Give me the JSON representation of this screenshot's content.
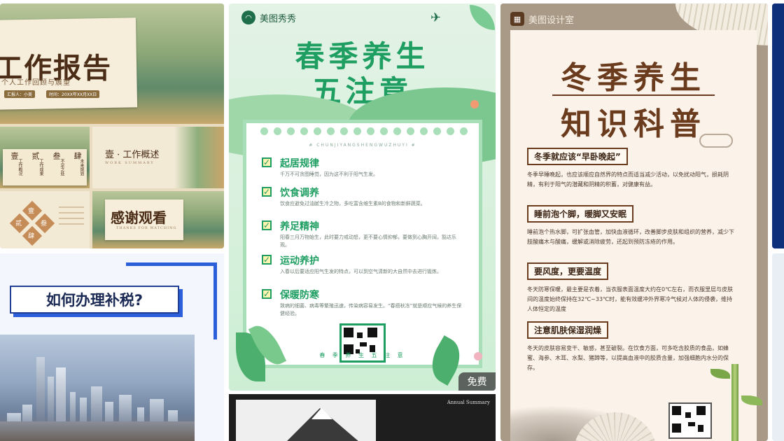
{
  "card_work_report": {
    "title": "工作报告",
    "subtitle": "个人工作回顾与展望",
    "meta_left": "汇报人：小美",
    "meta_right": "时间：20XX年XX月XX日",
    "section_titles": [
      "壹",
      "贰",
      "叁",
      "肆"
    ],
    "section_labels": [
      "工作概况",
      "工作成果",
      "不足之处",
      "未来规划"
    ],
    "overview_title": "壹 · 工作概述",
    "overview_sub": "WORK SUMMARY",
    "diamond_labels": [
      "壹",
      "贰",
      "叁",
      "肆"
    ],
    "thanks_title": "感谢观看",
    "thanks_sub": "THANKS FOR WATCHING"
  },
  "card_tax": {
    "title": "如何办理补税?"
  },
  "card_spring": {
    "brand": "美图秀秀",
    "title_line1": "春季养生",
    "title_line2": "五注意",
    "pinyin": "# CHUNJIYANGSHENGWUZHUYI #",
    "items": [
      {
        "heading": "起居规律",
        "text": "千万不可贪图睡觉，因为这不利于阳气生发。"
      },
      {
        "heading": "饮食调养",
        "text": "饮食应避免过油腻生冷之物，多吃富含维生素B的食物和新鲜蔬菜。"
      },
      {
        "heading": "养足精神",
        "text": "阳春三月万物始生，此时要力戒动怒，更不要心情抑郁，要做到心胸开阔，豁达乐观。"
      },
      {
        "heading": "运动养护",
        "text": "入春以后要适应阳气生发的特点，可以到空气清新的大自然中去进行锻炼。"
      },
      {
        "heading": "保暖防寒",
        "text": "致病的细菌、病毒等繁殖迅速，传染病容易发生。“春捂秋冻”就是顺应气候的养生保健经验。"
      }
    ],
    "footer": "春 季 养 生 五 注 意",
    "badge": "免费"
  },
  "card_winter": {
    "brand": "美图设计室",
    "title_line1": "冬季养生",
    "title_line2": "知识科普",
    "sections": [
      {
        "heading": "冬季就应该“早卧晚起”",
        "text": "冬季早睡晚起，也应该顺应自然界的特点而适当减少活动，以免扰动阳气，损耗阴精，有利于阳气的潜藏和阴精的积蓄，对健康有益。"
      },
      {
        "heading": "睡前泡个脚，暖脚又安眠",
        "text": "睡前泡个热水脚，可扩张血管，加快血液循环，改善脚步皮肤和组织的营养，减少下肢酸痛木与酸痛，缓解或消除疲劳，还起到预防冻疮的作用。"
      },
      {
        "heading": "要风度，更要温度",
        "text": "冬天防寒保暖，最主要是衣着，当衣服表面温度大约在0℃左右，而衣服里层与皮肤间的温度始终保持在32℃~33℃时，能有效缓冲外界寒冷气候对人体的侵袭，维持人体恒定的温度"
      },
      {
        "heading": "注意肌肤保湿润燥",
        "text": "冬天的皮肤容易变干、敏感，甚至破裂。在饮食方面，可多吃含胶质的食品，如蜂蜜、海参、木耳、水梨、猪蹄等，以提高血液中的胶质含量，加强细胞内水分的保存。"
      }
    ]
  },
  "card_mountain": {
    "caption": "Annual Summary"
  },
  "colors": {
    "spring_green": "#1f9e62",
    "winter_brown": "#6a3b1c",
    "tax_blue": "#2b5fd9"
  }
}
